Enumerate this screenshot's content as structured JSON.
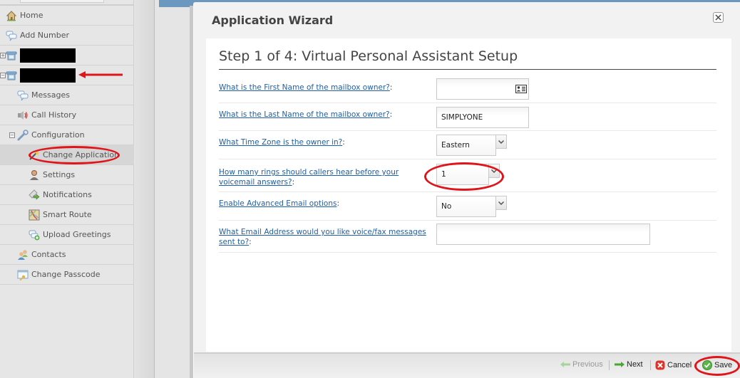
{
  "sidebar": {
    "items": [
      {
        "label": "Home",
        "icon": "home-icon"
      },
      {
        "label": "Add Number",
        "icon": "chat-bubbles-icon"
      },
      {
        "label": "",
        "icon": "phone-icon",
        "redacted": true,
        "toggle": "+"
      },
      {
        "label": "",
        "icon": "phone-icon",
        "redacted": true,
        "toggle": "-"
      },
      {
        "label": "Messages",
        "icon": "chat-bubbles-icon"
      },
      {
        "label": "Call History",
        "icon": "speaker-icon"
      },
      {
        "label": "Configuration",
        "icon": "wrench-icon",
        "toggle": "-"
      },
      {
        "label": "Change Application",
        "icon": "wand-icon",
        "active": true
      },
      {
        "label": "Settings",
        "icon": "user-icon"
      },
      {
        "label": "Notifications",
        "icon": "notification-icon"
      },
      {
        "label": "Smart Route",
        "icon": "map-icon"
      },
      {
        "label": "Upload Greetings",
        "icon": "upload-greeting-icon"
      },
      {
        "label": "Contacts",
        "icon": "contacts-icon"
      },
      {
        "label": "Change Passcode",
        "icon": "passcode-icon"
      }
    ]
  },
  "dialog": {
    "title": "Application Wizard",
    "close_icon": "close-icon",
    "step_title": "Step 1 of 4: Virtual Personal Assistant Setup",
    "fields": [
      {
        "label": "What is the First Name of the mailbox owner?",
        "suffix": ":",
        "type": "text",
        "value": "",
        "icon": "contact-card-icon"
      },
      {
        "label": "What is the Last Name of the mailbox owner?",
        "suffix": ":",
        "type": "text",
        "value": "SIMPLYONE"
      },
      {
        "label": "What Time Zone is the owner in?",
        "suffix": ":",
        "type": "select",
        "value": "Eastern"
      },
      {
        "label": "How many rings should callers hear before your voicemail answers?",
        "suffix": ":",
        "type": "select",
        "value": "1"
      },
      {
        "label": "Enable Advanced Email options",
        "suffix": ":",
        "type": "select",
        "value": "No"
      },
      {
        "label": "What Email Address would you like voice/fax messages sent to?",
        "suffix": ":",
        "type": "text",
        "value": ""
      }
    ],
    "footer": {
      "previous": "Previous",
      "next": "Next",
      "cancel": "Cancel",
      "save": "Save"
    }
  },
  "colors": {
    "link": "#1f5fa6",
    "annotation": "#e0141b",
    "header_blue": "#6c98bf"
  }
}
